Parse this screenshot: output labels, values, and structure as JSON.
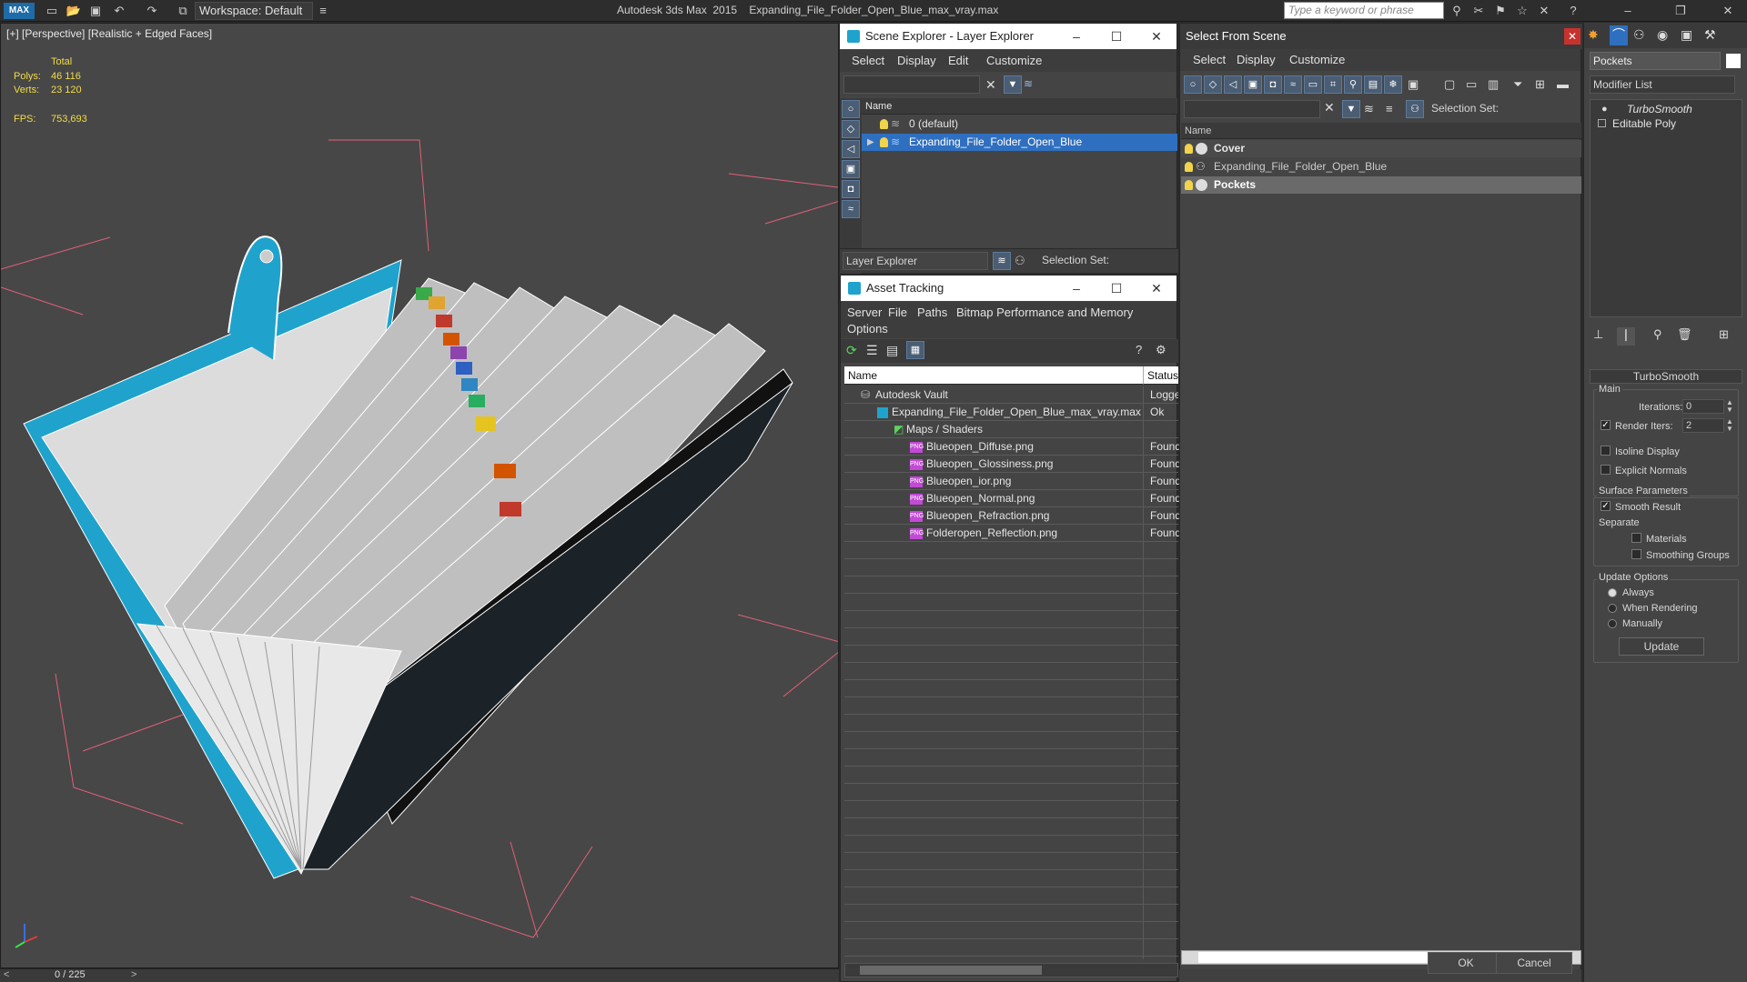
{
  "app": {
    "title": "Autodesk 3ds Max  2015    Expanding_File_Folder_Open_Blue_max_vray.max",
    "workspace": "Workspace: Default",
    "search_placeholder": "Type a keyword or phrase"
  },
  "viewport": {
    "label": "[+] [Perspective] [Realistic + Edged Faces]",
    "stats": {
      "total_label": "Total",
      "polys_label": "Polys:",
      "polys": "46 116",
      "verts_label": "Verts:",
      "verts": "23 120",
      "fps_label": "FPS:",
      "fps": "753,693"
    },
    "timeline": "0 / 225"
  },
  "scene_explorer": {
    "title": "Scene Explorer - Layer Explorer",
    "menu": [
      "Select",
      "Display",
      "Edit",
      "Customize"
    ],
    "column_name": "Name",
    "rows": [
      "0 (default)",
      "Expanding_File_Folder_Open_Blue"
    ],
    "footer_dropdown": "Layer Explorer",
    "selection_set_label": "Selection Set:"
  },
  "asset_tracking": {
    "title": "Asset Tracking",
    "menu1": [
      "Server",
      "File",
      "Paths",
      "Bitmap Performance and Memory"
    ],
    "menu2": [
      "Options"
    ],
    "col_name": "Name",
    "col_status": "Status",
    "rows": [
      {
        "name": "Autodesk Vault",
        "status": "Logged"
      },
      {
        "name": "Expanding_File_Folder_Open_Blue_max_vray.max",
        "status": "Ok"
      },
      {
        "name": "Maps / Shaders",
        "status": ""
      },
      {
        "name": "Blueopen_Diffuse.png",
        "status": "Found"
      },
      {
        "name": "Blueopen_Glossiness.png",
        "status": "Found"
      },
      {
        "name": "Blueopen_ior.png",
        "status": "Found"
      },
      {
        "name": "Blueopen_Normal.png",
        "status": "Found"
      },
      {
        "name": "Blueopen_Refraction.png",
        "status": "Found"
      },
      {
        "name": "Folderopen_Reflection.png",
        "status": "Found"
      }
    ]
  },
  "select_from_scene": {
    "title": "Select From Scene",
    "menu": [
      "Select",
      "Display",
      "Customize"
    ],
    "selection_set_label": "Selection Set:",
    "column_name": "Name",
    "rows": [
      "Cover",
      "Expanding_File_Folder_Open_Blue",
      "Pockets"
    ],
    "ok": "OK",
    "cancel": "Cancel"
  },
  "command_panel": {
    "object_name": "Pockets",
    "modifier_list": "Modifier List",
    "stack": [
      "TurboSmooth",
      "Editable Poly"
    ],
    "rollout_title": "TurboSmooth",
    "main_label": "Main",
    "iterations_label": "Iterations:",
    "iterations": "0",
    "render_iters_label": "Render Iters:",
    "render_iters": "2",
    "isoline": "Isoline Display",
    "explicit_normals": "Explicit Normals",
    "surface_params": "Surface Parameters",
    "smooth_result": "Smooth Result",
    "separate": "Separate",
    "materials": "Materials",
    "smoothing_groups": "Smoothing Groups",
    "update_options": "Update Options",
    "always": "Always",
    "when_rendering": "When Rendering",
    "manually": "Manually",
    "update_button": "Update"
  },
  "colors": {
    "accent": "#2f6fbf",
    "selection": "#3a6dc4",
    "stats_yellow": "#f2dc44",
    "folder_blue": "#1fa3cc"
  }
}
